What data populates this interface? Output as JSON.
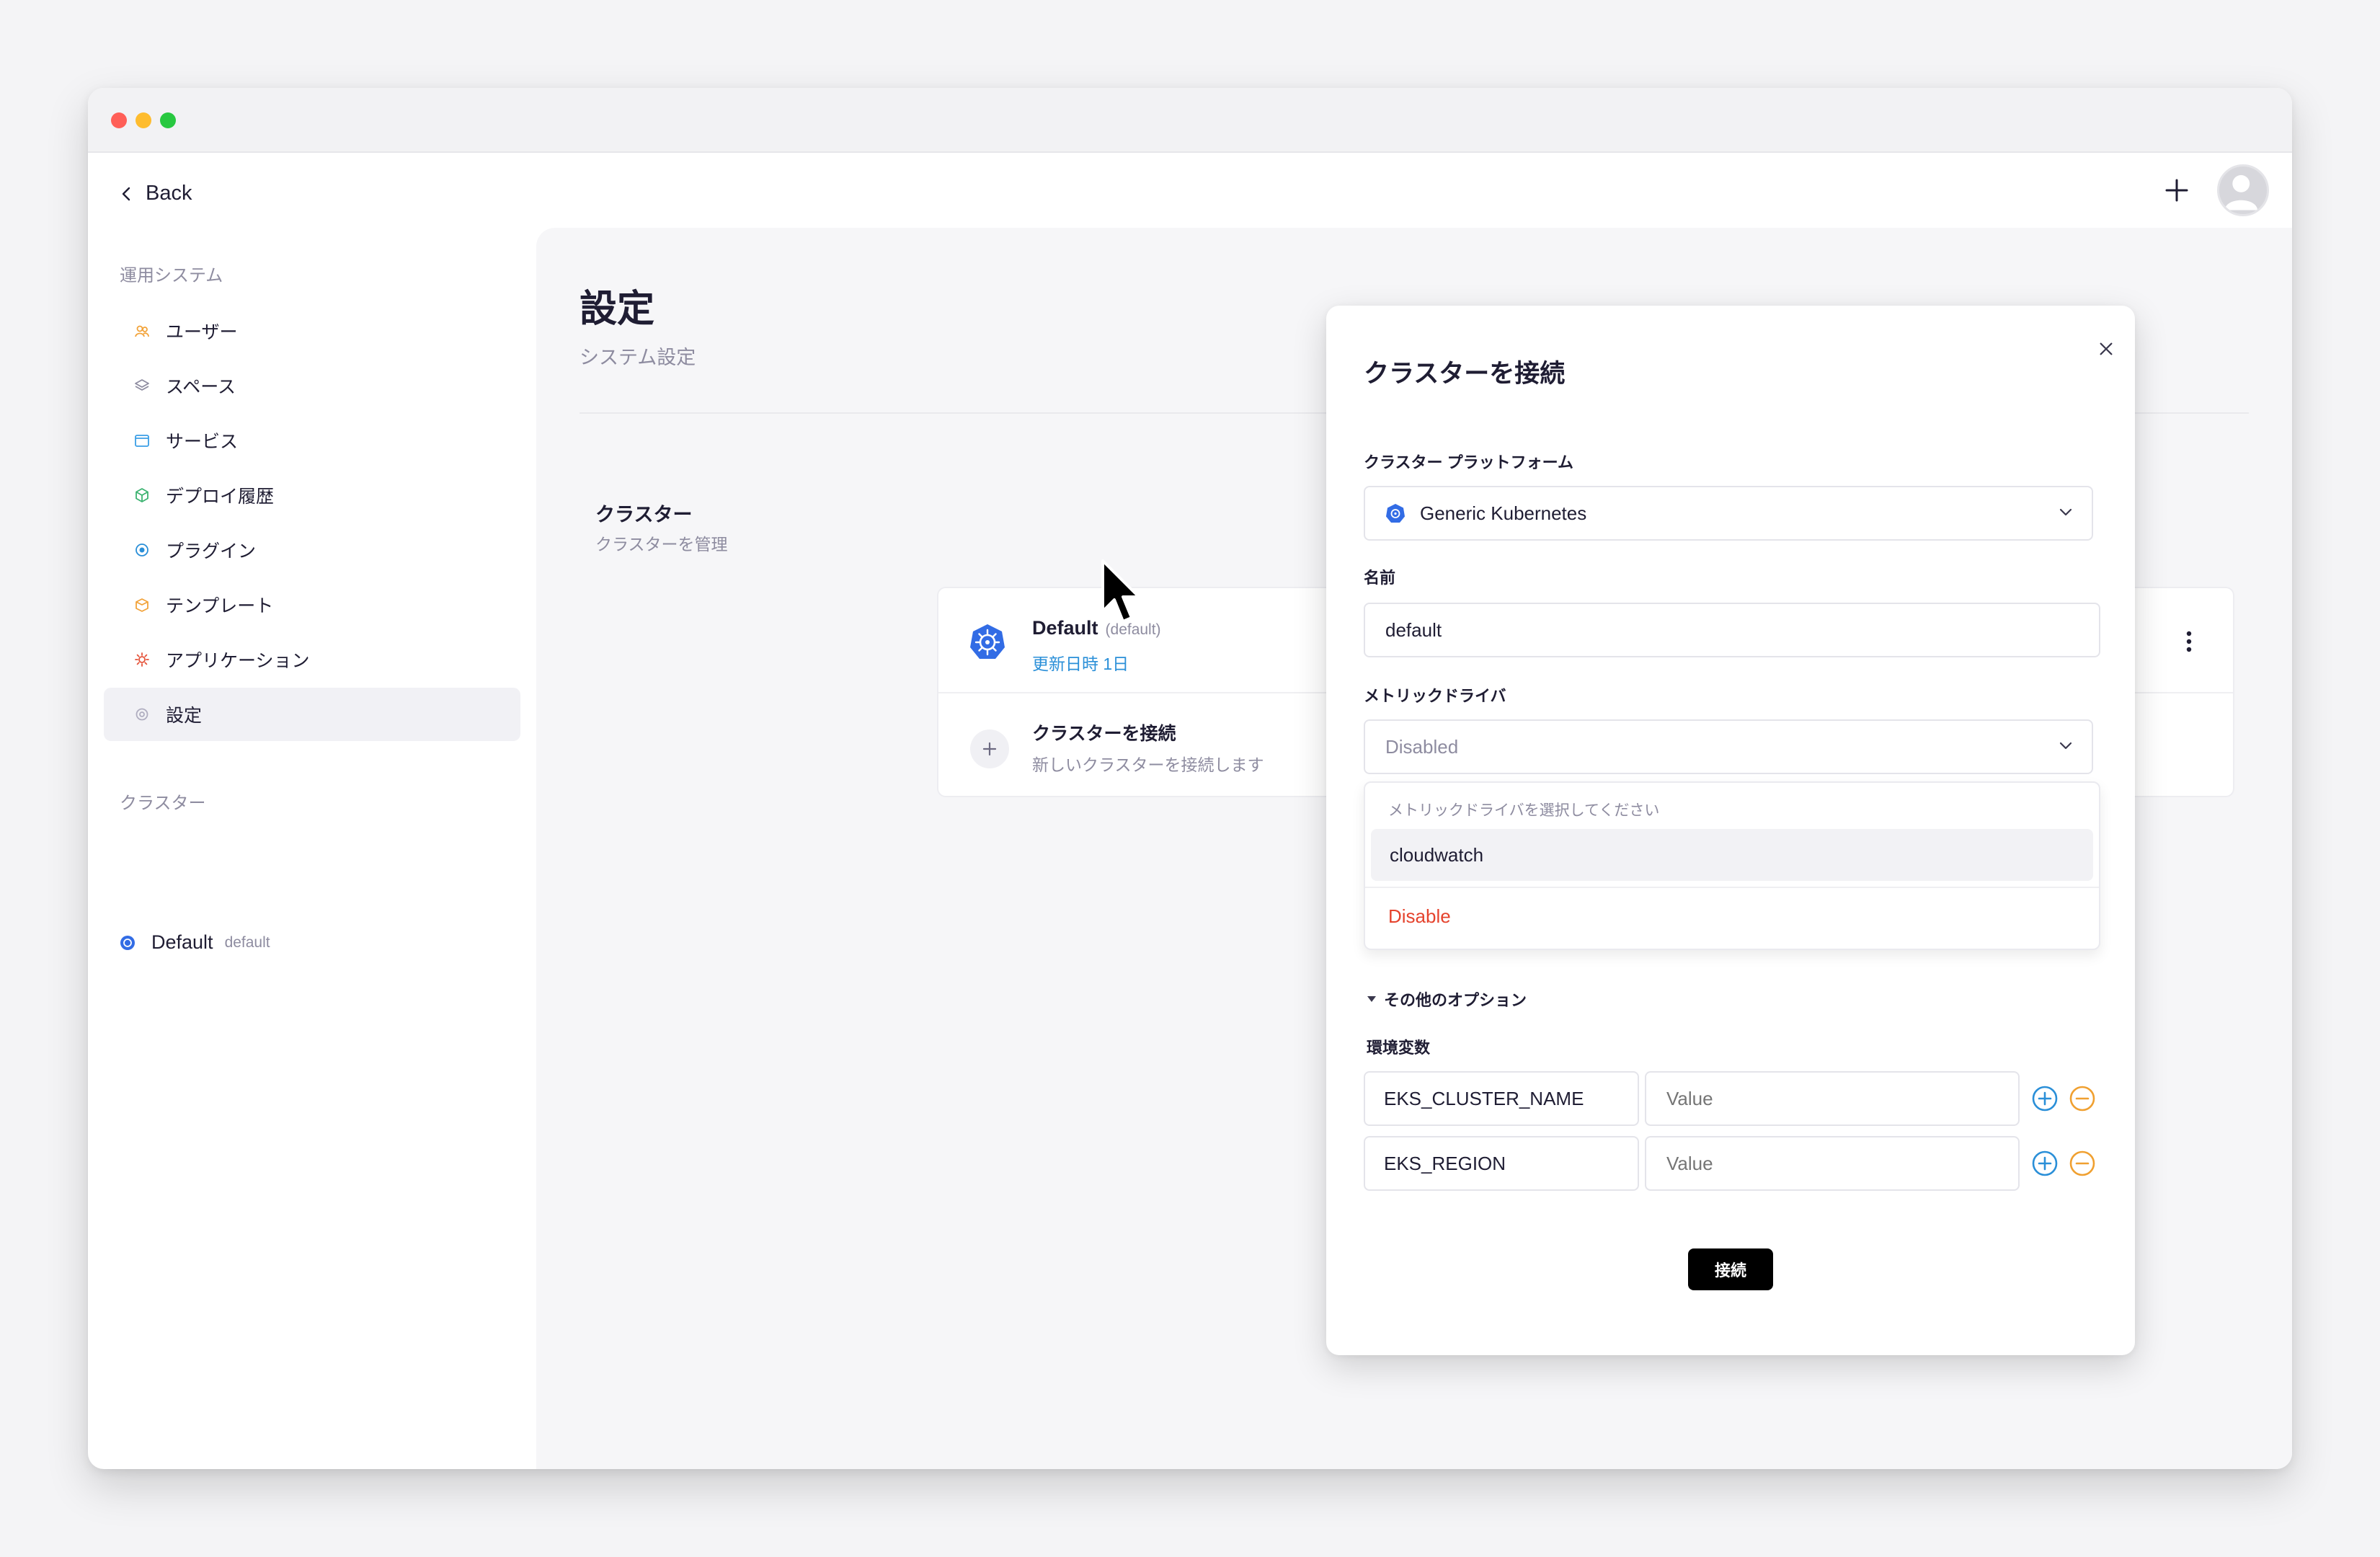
{
  "nav": {
    "back_label": "Back"
  },
  "sidebar": {
    "section_title": "運用システム",
    "items": [
      {
        "label": "ユーザー",
        "icon": "users-icon",
        "color": "#f2a33a"
      },
      {
        "label": "スペース",
        "icon": "layers-icon",
        "color": "#8e8ca0"
      },
      {
        "label": "サービス",
        "icon": "window-icon",
        "color": "#3b9fe6"
      },
      {
        "label": "デプロイ履歴",
        "icon": "cube-icon",
        "color": "#3cb371"
      },
      {
        "label": "プラグイン",
        "icon": "plugin-icon",
        "color": "#2a8fd8"
      },
      {
        "label": "テンプレート",
        "icon": "box-icon",
        "color": "#f2a33a"
      },
      {
        "label": "アプリケーション",
        "icon": "gear-app-icon",
        "color": "#e5543b"
      },
      {
        "label": "設定",
        "icon": "settings-icon",
        "color": "#b0aec0"
      }
    ],
    "active_item": "設定",
    "cluster_section_title": "クラスター",
    "cluster": {
      "name": "Default",
      "sub": "default"
    }
  },
  "page": {
    "title": "設定",
    "subtitle": "システム設定",
    "section_title": "クラスター",
    "section_subtitle": "クラスターを管理"
  },
  "cluster_card": {
    "name": "Default",
    "default_tag": "(default)",
    "updated_text": "更新日時 1日"
  },
  "add_cluster": {
    "title": "クラスターを接続",
    "subtitle": "新しいクラスターを接続します"
  },
  "modal": {
    "title": "クラスターを接続",
    "platform_label": "クラスター プラットフォーム",
    "platform_value": "Generic Kubernetes",
    "name_label": "名前",
    "name_value": "default",
    "metrics_label": "メトリックドライバ",
    "metrics_value": "Disabled",
    "dropdown": {
      "hint": "メトリックドライバを選択してください",
      "options": [
        "cloudwatch"
      ],
      "disable_label": "Disable"
    },
    "other_options_label": "その他のオプション",
    "env_label": "環境変数",
    "env_rows": [
      {
        "key": "EKS_CLUSTER_NAME",
        "value_placeholder": "Value"
      },
      {
        "key": "EKS_REGION",
        "value_placeholder": "Value"
      }
    ],
    "submit_label": "接続"
  },
  "colors": {
    "accent_blue": "#2a8fd8",
    "kubernetes_blue": "#326ce5",
    "danger": "#e5432d",
    "remove_orange": "#f0a030"
  }
}
